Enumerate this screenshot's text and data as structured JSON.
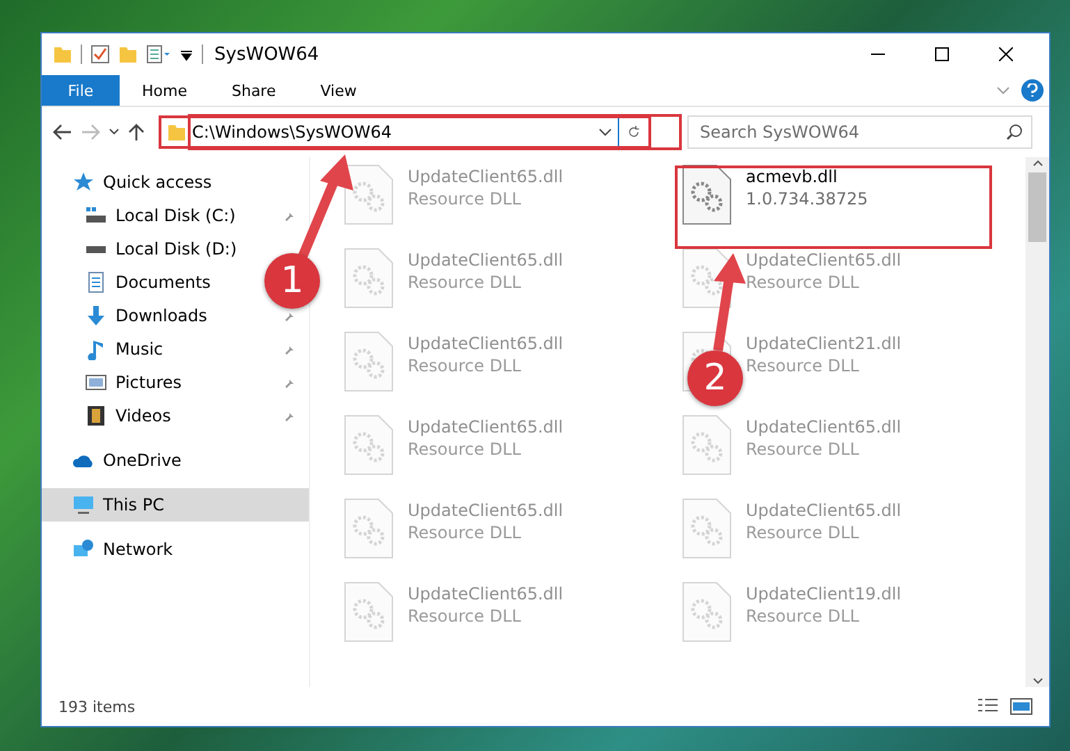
{
  "window": {
    "title": "SysWOW64"
  },
  "ribbon_tabs": [
    {
      "label": "File",
      "selected": true
    },
    {
      "label": "Home",
      "selected": false
    },
    {
      "label": "Share",
      "selected": false
    },
    {
      "label": "View",
      "selected": false
    }
  ],
  "address_bar": {
    "path": "C:\\Windows\\SysWOW64"
  },
  "search": {
    "placeholder": "Search SysWOW64"
  },
  "sidebar": {
    "items": [
      {
        "label": "Quick access",
        "selected": false,
        "children": [
          {
            "label": "Local Disk (C:)",
            "pinned": true,
            "selected": false
          },
          {
            "label": "Local Disk (D:)",
            "pinned": false,
            "selected": false
          },
          {
            "label": "Documents",
            "pinned": false,
            "selected": false
          },
          {
            "label": "Downloads",
            "pinned": true,
            "selected": false
          },
          {
            "label": "Music",
            "pinned": true,
            "selected": false
          },
          {
            "label": "Pictures",
            "pinned": true,
            "selected": false
          },
          {
            "label": "Videos",
            "pinned": true,
            "selected": false
          }
        ]
      },
      {
        "label": "OneDrive",
        "selected": false
      },
      {
        "label": "This PC",
        "selected": true
      },
      {
        "label": "Network",
        "selected": false
      }
    ]
  },
  "files": [
    {
      "name": "UpdateClient65.dll",
      "detail": "Resource DLL",
      "faded": true
    },
    {
      "name": "acmevb.dll",
      "detail": "1.0.734.38725",
      "faded": false
    },
    {
      "name": "UpdateClient65.dll",
      "detail": "Resource DLL",
      "faded": true
    },
    {
      "name": "UpdateClient65.dll",
      "detail": "Resource DLL",
      "faded": true
    },
    {
      "name": "UpdateClient65.dll",
      "detail": "Resource DLL",
      "faded": true
    },
    {
      "name": "UpdateClient21.dll",
      "detail": "Resource DLL",
      "faded": true
    },
    {
      "name": "UpdateClient65.dll",
      "detail": "Resource DLL",
      "faded": true
    },
    {
      "name": "UpdateClient65.dll",
      "detail": "Resource DLL",
      "faded": true
    },
    {
      "name": "UpdateClient65.dll",
      "detail": "Resource DLL",
      "faded": true
    },
    {
      "name": "UpdateClient65.dll",
      "detail": "Resource DLL",
      "faded": true
    },
    {
      "name": "UpdateClient65.dll",
      "detail": "Resource DLL",
      "faded": true
    },
    {
      "name": "UpdateClient19.dll",
      "detail": "Resource DLL",
      "faded": true
    }
  ],
  "status_bar": {
    "item_count": "193 items"
  },
  "annotations": [
    {
      "label": "1"
    },
    {
      "label": "2"
    }
  ]
}
